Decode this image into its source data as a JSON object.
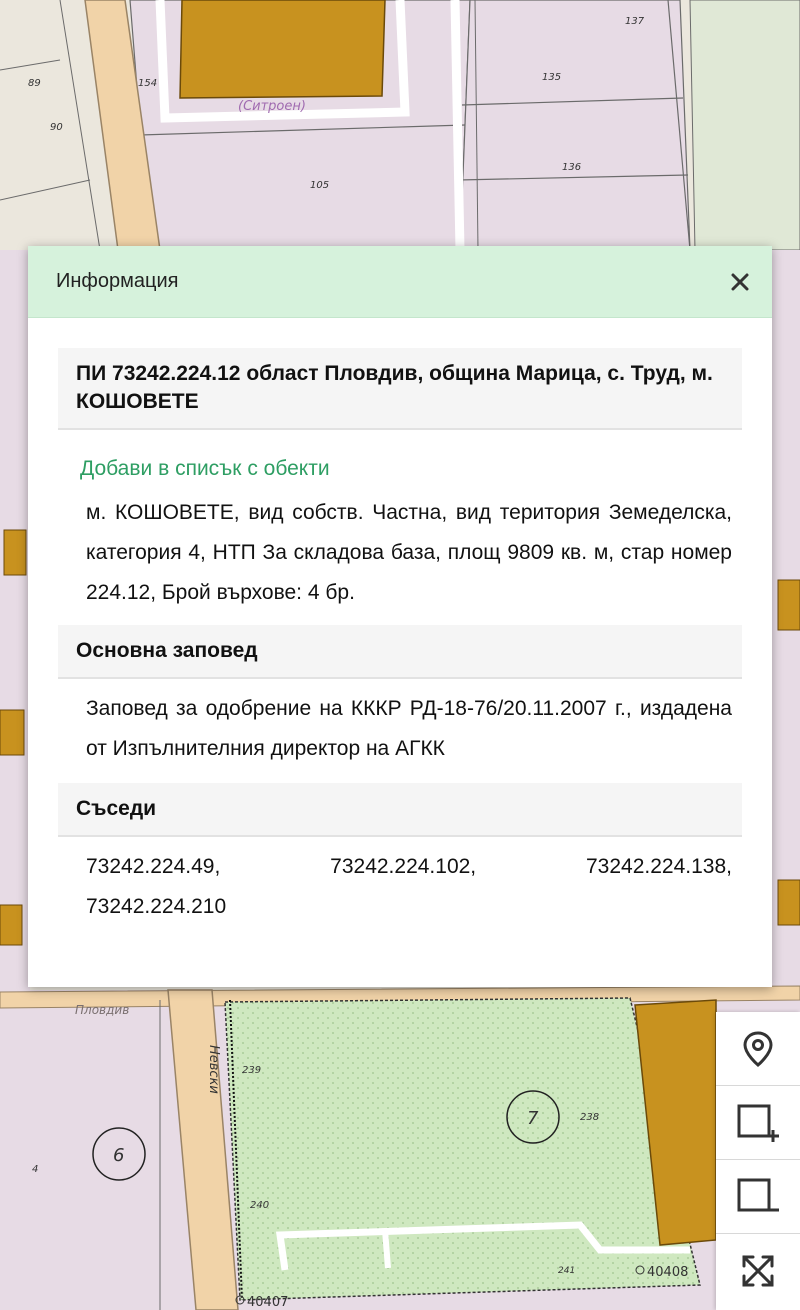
{
  "map": {
    "parcel_labels": [
      "89",
      "90",
      "154",
      "135",
      "137",
      "105",
      "136",
      "239",
      "238",
      "240",
      "241",
      "4"
    ],
    "street_labels": [
      "(Ситроен)",
      "Пловдив",
      "Невски"
    ],
    "region_markers": [
      "6",
      "7"
    ],
    "point_labels": [
      "40407",
      "40408"
    ]
  },
  "panel": {
    "title": "Информация",
    "parcel_heading": "ПИ 73242.224.12 област Пловдив, община Марица, с. Труд, м. КОШОВЕТЕ",
    "add_link": "Добави в списък с обекти",
    "description": "м. КОШОВЕТЕ, вид собств. Частна, вид територия Земеделска, категория 4, НТП За складова база, площ 9809 кв. м, стар номер 224.12, Брой върхове: 4 бр.",
    "order_heading": "Основна заповед",
    "order_text": "Заповед за одобрение на КККР РД-18-76/20.11.2007 г., издадена от Изпълнителния директор на АГКК",
    "neighbors_heading": "Съседи",
    "neighbors": [
      "73242.224.49,",
      "73242.224.102,",
      "73242.224.138,",
      "73242.224.210"
    ]
  },
  "toolbar": {
    "icons": [
      "location-pin-icon",
      "zoom-box-in-icon",
      "zoom-box-out-icon",
      "fullscreen-icon"
    ]
  },
  "colors": {
    "header_bg": "#d6f2dc",
    "link": "#2e9e63",
    "building": "#c8921f",
    "parcel": "#e6dbe4",
    "green_area": "#cfe8c0"
  }
}
